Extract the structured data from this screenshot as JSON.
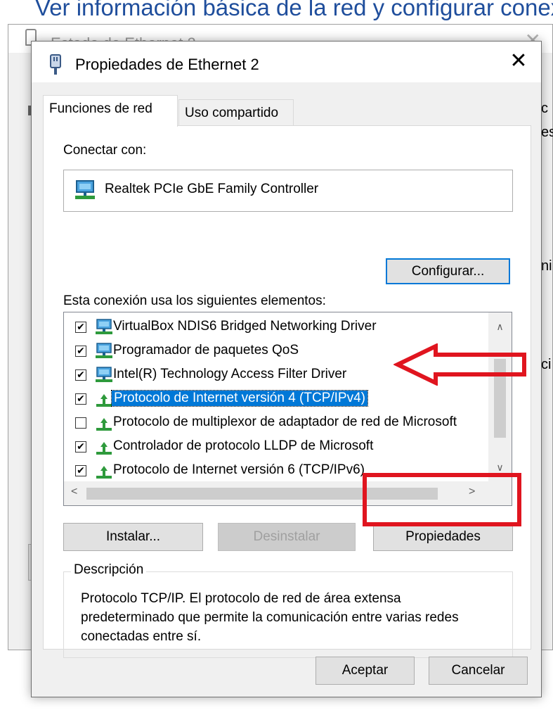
{
  "background": {
    "heading": "Ver información básica de la red y configurar conexiones",
    "window_title": "Estado de Ethernet 2",
    "close_glyph": "✕",
    "right_fragments": [
      "c",
      "es",
      "ni",
      "ci"
    ]
  },
  "dialog": {
    "title": "Propiedades de Ethernet 2",
    "close_glyph": "✕",
    "tabs": [
      {
        "label": "Funciones de red",
        "active": true
      },
      {
        "label": "Uso compartido",
        "active": false
      }
    ],
    "connect_with_label": "Conectar con:",
    "adapter_name": "Realtek PCIe GbE Family Controller",
    "configure_button": "Configurar...",
    "elements_label": "Esta conexión usa los siguientes elementos:",
    "items": [
      {
        "label": "VirtualBox NDIS6 Bridged Networking Driver",
        "checked": true,
        "icon": "network-adapter-icon",
        "selected": false
      },
      {
        "label": "Programador de paquetes QoS",
        "checked": true,
        "icon": "network-adapter-icon",
        "selected": false
      },
      {
        "label": "Intel(R) Technology Access Filter Driver",
        "checked": true,
        "icon": "network-adapter-icon",
        "selected": false
      },
      {
        "label": "Protocolo de Internet versión 4 (TCP/IPv4)",
        "checked": true,
        "icon": "protocol-icon",
        "selected": true
      },
      {
        "label": "Protocolo de multiplexor de adaptador de red de Microsoft",
        "checked": false,
        "icon": "protocol-icon",
        "selected": false
      },
      {
        "label": "Controlador de protocolo LLDP de Microsoft",
        "checked": true,
        "icon": "protocol-icon",
        "selected": false
      },
      {
        "label": "Protocolo de Internet versión 6 (TCP/IPv6)",
        "checked": true,
        "icon": "protocol-icon",
        "selected": false
      }
    ],
    "check_glyph": "✔",
    "scroll": {
      "up": "∧",
      "down": "∨",
      "left": "<",
      "right": ">"
    },
    "install_button": "Instalar...",
    "uninstall_button": "Desinstalar",
    "properties_button": "Propiedades",
    "description_legend": "Descripción",
    "description_text": "Protocolo TCP/IP. El protocolo de red de área extensa predeterminado que permite la comunicación entre varias redes conectadas entre sí.",
    "ok_button": "Aceptar",
    "cancel_button": "Cancelar"
  },
  "colors": {
    "selection": "#0078d7",
    "annotation_red": "#e0151f",
    "heading_blue": "#1f4e9c"
  }
}
